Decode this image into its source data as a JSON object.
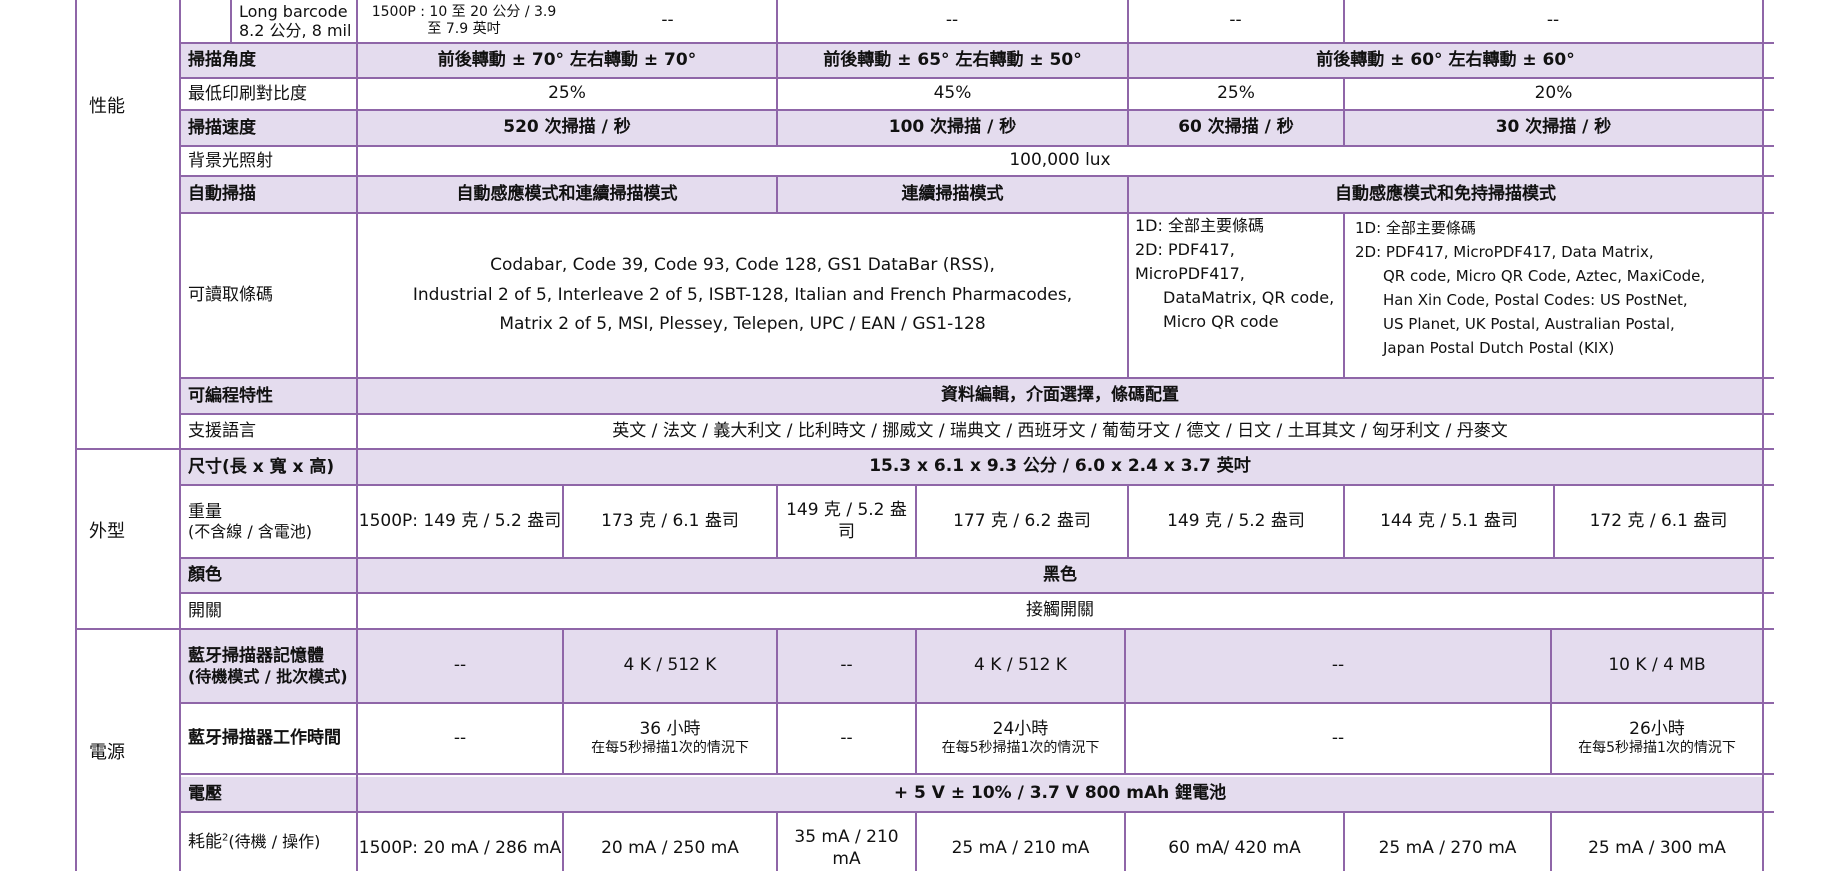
{
  "colors": {
    "border": "#8f66a8",
    "shade": "#e4dcee"
  },
  "sections": {
    "performance": "性能",
    "appearance": "外型",
    "power": "電源"
  },
  "rows": {
    "barcode": {
      "label_1": "Long barcode",
      "label_2": "8.2 公分, 8 mil",
      "c1": "1500P : 10 至 20 公分 / 3.9 至 7.9 英吋",
      "c2": "--",
      "c3": "--",
      "c4": "--",
      "c5": "--"
    },
    "scan_angle": {
      "label": "掃描角度",
      "c1": "前後轉動 ± 70° 左右轉動 ± 70°",
      "c2": "前後轉動 ± 65° 左右轉動 ± 50°",
      "c3": "前後轉動 ± 60° 左右轉動 ± 60°"
    },
    "contrast": {
      "label": "最低印刷對比度",
      "c1": "25%",
      "c2": "45%",
      "c3": "25%",
      "c4": "20%"
    },
    "scan_speed": {
      "label": "掃描速度",
      "c1": "520 次掃描 / 秒",
      "c2": "100 次掃描 / 秒",
      "c3": "60 次掃描 / 秒",
      "c4": "30 次掃描 / 秒"
    },
    "ambient": {
      "label": "背景光照射",
      "value": "100,000 lux"
    },
    "auto_scan": {
      "label": "自動掃描",
      "c1": "自動感應模式和連續掃描模式",
      "c2": "連續掃描模式",
      "c3": "自動感應模式和免持掃描模式"
    },
    "symbologies": {
      "label": "可讀取條碼",
      "main_lines": [
        "Codabar, Code 39, Code 93, Code 128, GS1 DataBar (RSS),",
        "Industrial 2 of 5, Interleave 2 of 5, ISBT-128, Italian and French Pharmacodes,",
        "Matrix 2 of 5, MSI, Plessey, Telepen, UPC / EAN / GS1-128"
      ],
      "mid_lines": [
        "1D: 全部主要條碼",
        "2D: PDF417, MicroPDF417,",
        "DataMatrix, QR code,",
        "Micro QR code"
      ],
      "right_lines": [
        "1D: 全部主要條碼",
        "2D: PDF417, MicroPDF417, Data Matrix,",
        "QR code, Micro QR Code, Aztec, MaxiCode,",
        "Han Xin Code, Postal Codes: US PostNet,",
        "US Planet, UK Postal, Australian Postal,",
        "Japan Postal Dutch Postal (KIX)"
      ]
    },
    "programmable": {
      "label": "可編程特性",
      "value": "資料編輯，介面選擇，條碼配置"
    },
    "languages": {
      "label": "支援語言",
      "value": "英文 / 法文 / 義大利文 / 比利時文 / 挪威文 / 瑞典文 / 西班牙文 / 葡萄牙文 / 德文 / 日文 / 土耳其文 / 匈牙利文 / 丹麥文"
    },
    "dimensions": {
      "label": "尺寸(長 x 寬 x 高)",
      "value": "15.3 x 6.1 x 9.3 公分 / 6.0 x 2.4 x 3.7 英吋"
    },
    "weight": {
      "label_1": "重量",
      "label_2": "(不含線 / 含電池)",
      "values": [
        "1500P: 149 克 / 5.2 盎司",
        "173 克 / 6.1 盎司",
        "149 克 / 5.2 盎司",
        "177 克 / 6.2 盎司",
        "149 克 / 5.2 盎司",
        "144 克 / 5.1 盎司",
        "172 克 / 6.1 盎司"
      ]
    },
    "color": {
      "label": "顏色",
      "value": "黑色"
    },
    "switch": {
      "label": "開關",
      "value": "接觸開關"
    },
    "bt_memory": {
      "label_1": "藍牙掃描器記憶體",
      "label_2": "(待機模式 / 批次模式)",
      "values": [
        "--",
        "4 K / 512 K",
        "--",
        "4 K / 512 K",
        "--",
        "10 K / 4 MB"
      ]
    },
    "bt_runtime": {
      "label": "藍牙掃描器工作時間",
      "v1": "--",
      "v2_main": "36 小時",
      "v2_sub": "在每5秒掃描1次的情況下",
      "v3": "--",
      "v4_main": "24小時",
      "v4_sub": "在每5秒掃描1次的情況下",
      "v5": "--",
      "v6_main": "26小時",
      "v6_sub": "在每5秒掃描1次的情況下"
    },
    "voltage": {
      "label": "電壓",
      "value": "+ 5 V ± 10% / 3.7 V 800 mAh 鋰電池"
    },
    "power_consumption": {
      "label": "耗能",
      "superscript": "2",
      "label_suffix": "(待機 / 操作)",
      "values": [
        "1500P: 20 mA / 286 mA",
        "20 mA / 250 mA",
        "35 mA / 210 mA",
        "25 mA / 210 mA",
        "60 mA/ 420 mA",
        "25 mA / 270 mA",
        "25 mA / 300 mA"
      ]
    }
  }
}
